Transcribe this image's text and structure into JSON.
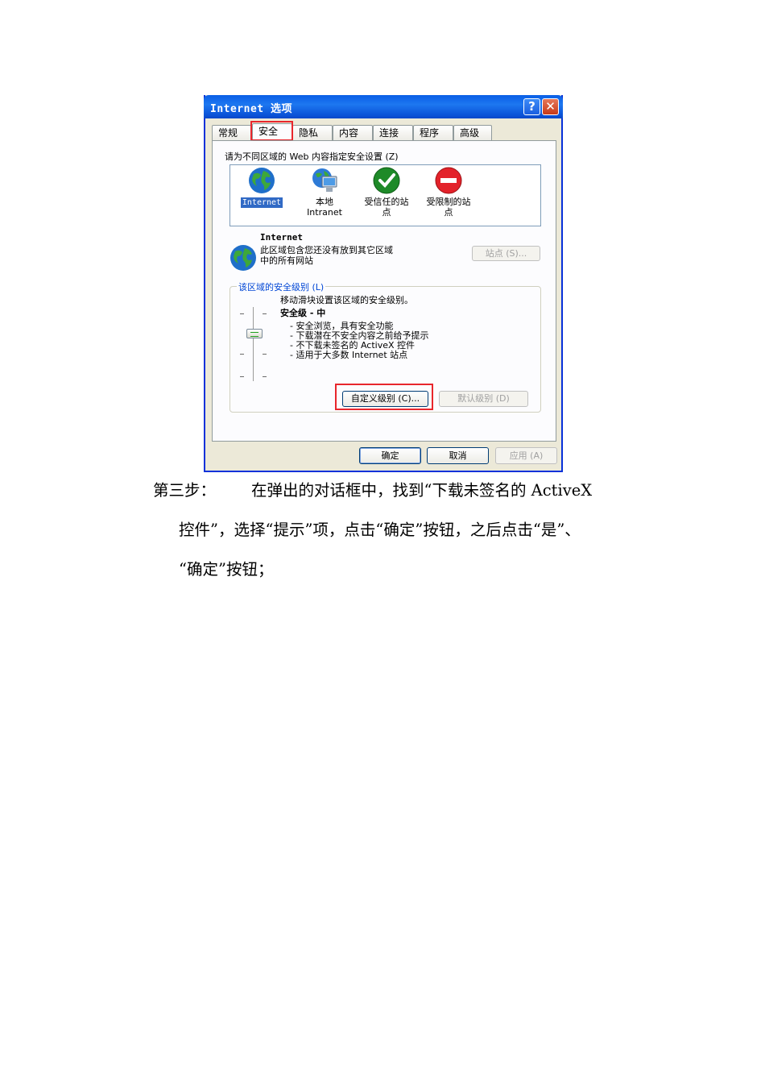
{
  "dialog": {
    "title": "Internet 选项",
    "help_glyph": "?",
    "close_glyph": "✕",
    "tabs": [
      "常规",
      "安全",
      "隐私",
      "内容",
      "连接",
      "程序",
      "高级"
    ],
    "active_tab": "安全",
    "zone_prompt": "请为不同区域的 Web 内容指定安全设置 (Z)",
    "zones": [
      {
        "label": "Internet",
        "selected": true
      },
      {
        "label": "本地\nIntranet",
        "selected": false
      },
      {
        "label": "受信任的站\n点",
        "selected": false
      },
      {
        "label": "受限制的站\n点",
        "selected": false
      }
    ],
    "zone_info": {
      "name": "Internet",
      "desc_line1": "此区域包含您还没有放到其它区域",
      "desc_line2": "中的所有网站"
    },
    "sites_button": "站点 (S)...",
    "security_level": {
      "legend": "该区域的安全级别 (L)",
      "instruction": "移动滑块设置该区域的安全级别。",
      "level_title": "安全级 - 中",
      "bullets": [
        "- 安全浏览，具有安全功能",
        "- 下载潜在不安全内容之前给予提示",
        "- 不下载未签名的 ActiveX 控件",
        "- 适用于大多数 Internet 站点"
      ],
      "custom_button": "自定义级别 (C)...",
      "default_button": "默认级别 (D)"
    },
    "buttons": {
      "ok": "确定",
      "cancel": "取消",
      "apply": "应用 (A)"
    }
  },
  "instruction": {
    "step_label": "第三步：",
    "line1": "在弹出的对话框中，找到“下载未签名的 ActiveX",
    "line2": "控件”，选择“提示”项，点击“确定”按钮，之后点击“是”、",
    "line3": "“确定”按钮；"
  },
  "colors": {
    "titlebar": "#0a5fe6",
    "highlight": "#e8262c",
    "selection": "#316ac5",
    "panel_bg": "#fcfcfe",
    "dialog_bg": "#ece9d8"
  }
}
